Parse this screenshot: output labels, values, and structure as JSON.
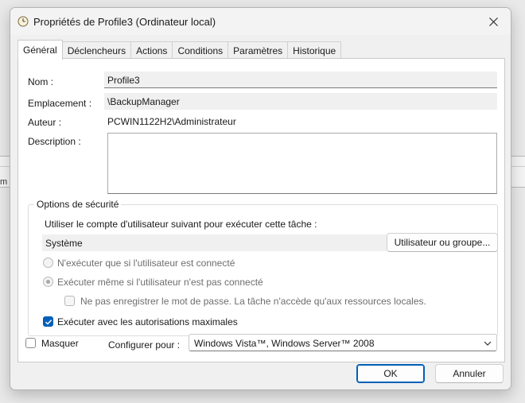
{
  "window": {
    "title": "Propriétés de Profile3 (Ordinateur local)",
    "icon": "clock-icon"
  },
  "background": {
    "partial_text": "m"
  },
  "tabs": [
    {
      "label": "Général",
      "active": true
    },
    {
      "label": "Déclencheurs",
      "active": false
    },
    {
      "label": "Actions",
      "active": false
    },
    {
      "label": "Conditions",
      "active": false
    },
    {
      "label": "Paramètres",
      "active": false
    },
    {
      "label": "Historique",
      "active": false
    }
  ],
  "general": {
    "name_label": "Nom :",
    "name_value": "Profile3",
    "location_label": "Emplacement :",
    "location_value": "\\BackupManager",
    "author_label": "Auteur :",
    "author_value": "PCWIN1122H2\\Administrateur",
    "description_label": "Description :",
    "description_value": ""
  },
  "security": {
    "group_title": "Options de sécurité",
    "account_prompt": "Utiliser le compte d'utilisateur suivant pour exécuter cette tâche :",
    "account_value": "Système",
    "change_user_button": "Utilisateur ou groupe...",
    "radio_logged_on": {
      "label": "N'exécuter que si l'utilisateur est connecté",
      "selected": false,
      "enabled": false
    },
    "radio_not_logged_on": {
      "label": "Exécuter même si l'utilisateur n'est pas connecté",
      "selected": true,
      "enabled": false
    },
    "no_store_password": {
      "label": "Ne pas enregistrer le mot de passe. La tâche n'accède qu'aux ressources locales.",
      "checked": false,
      "enabled": false
    },
    "highest_privileges": {
      "label": "Exécuter avec les autorisations maximales",
      "checked": true
    }
  },
  "footer": {
    "hidden_label": "Masquer",
    "hidden_checked": false,
    "configure_label": "Configurer pour :",
    "configure_value": "Windows Vista™, Windows Server™ 2008",
    "ok_button": "OK",
    "cancel_button": "Annuler"
  },
  "colors": {
    "accent": "#005fb8",
    "dialog_bg": "#f0f0f0",
    "panel_bg": "#ffffff"
  }
}
